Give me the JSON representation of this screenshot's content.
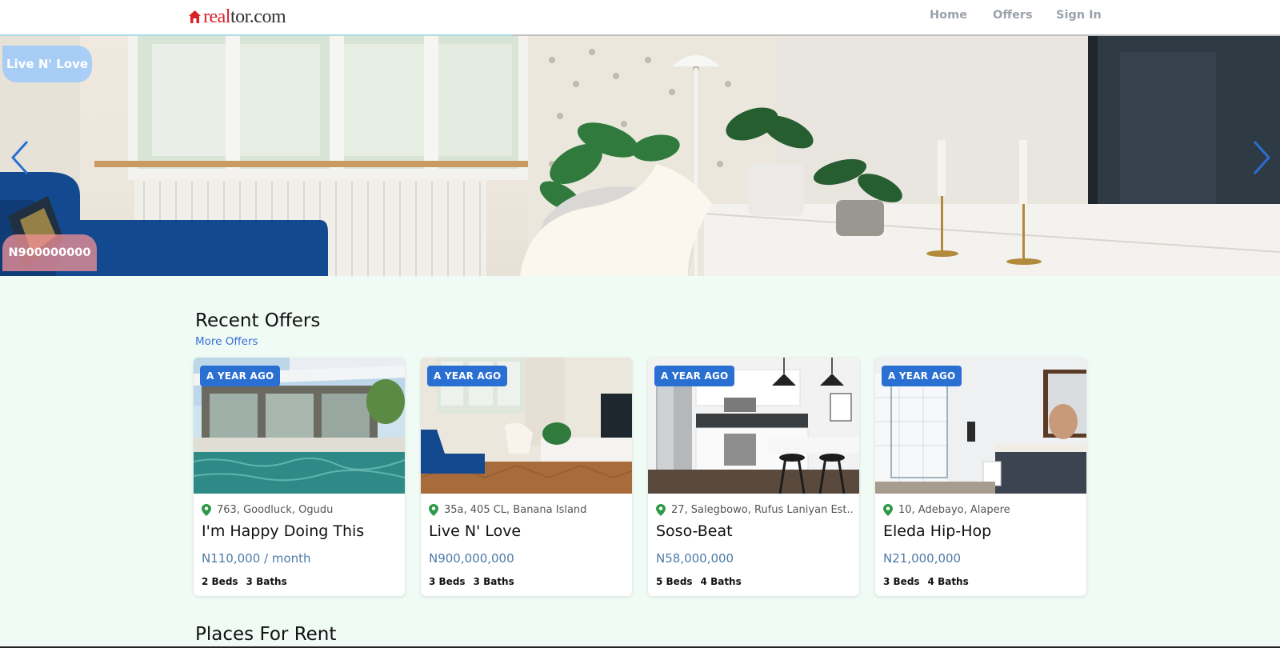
{
  "header": {
    "logo_text_red": "real",
    "logo_text_dark": "tor.com",
    "nav": {
      "home": "Home",
      "offers": "Offers",
      "signin": "Sign In"
    }
  },
  "hero": {
    "title": "Live N' Love",
    "price": "N900000000"
  },
  "recent": {
    "title": "Recent Offers",
    "more_link": "More Offers",
    "cards": [
      {
        "age": "A YEAR AGO",
        "location": "763, Goodluck, Ogudu",
        "name": "I'm Happy Doing This",
        "price": "N110,000 / month",
        "beds": "2 Beds",
        "baths": "3 Baths"
      },
      {
        "age": "A YEAR AGO",
        "location": "35a, 405 CL, Banana Island",
        "name": "Live N' Love",
        "price": "N900,000,000",
        "beds": "3 Beds",
        "baths": "3 Baths"
      },
      {
        "age": "A YEAR AGO",
        "location": "27, Salegbowo, Rufus Laniyan Est...",
        "name": "Soso-Beat",
        "price": "N58,000,000",
        "beds": "5 Beds",
        "baths": "4 Baths"
      },
      {
        "age": "A YEAR AGO",
        "location": "10, Adebayo, Alapere",
        "name": "Eleda Hip-Hop",
        "price": "N21,000,000",
        "beds": "3 Beds",
        "baths": "4 Baths"
      }
    ]
  },
  "rent": {
    "title": "Places For Rent"
  },
  "colors": {
    "accent": "#2a6fd2",
    "brand_red": "#d92228",
    "background": "#effbf4"
  },
  "icons": {
    "pin": "map-pin-icon",
    "prev": "chevron-left-icon",
    "next": "chevron-right-icon"
  }
}
